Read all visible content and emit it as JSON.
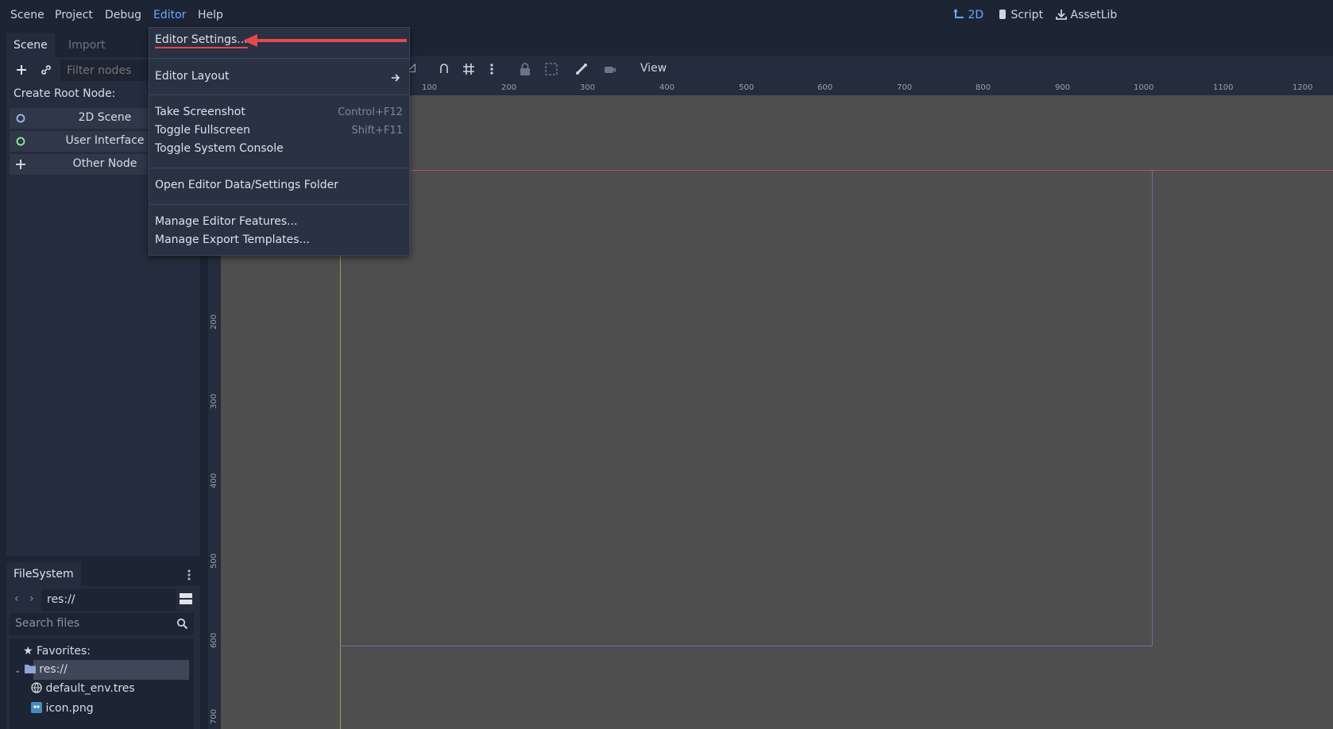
{
  "menubar": {
    "items": [
      "Scene",
      "Project",
      "Debug",
      "Editor",
      "Help"
    ],
    "active_index": 3
  },
  "workspaces": [
    {
      "label": "2D",
      "icon": "2d-icon",
      "active": true
    },
    {
      "label": "Script",
      "icon": "script-icon",
      "active": false
    },
    {
      "label": "AssetLib",
      "icon": "assetlib-icon",
      "active": false
    }
  ],
  "scene_dock": {
    "tabs": [
      "Scene",
      "Import"
    ],
    "filter_placeholder": "Filter nodes",
    "create_root_label": "Create Root Node:",
    "root_options": [
      {
        "label": "2D Scene",
        "icon": "node2d-icon"
      },
      {
        "label": "User Interface",
        "icon": "control-icon"
      },
      {
        "label": "Other Node",
        "icon": "add-icon"
      }
    ]
  },
  "filesystem": {
    "title": "FileSystem",
    "path": "res://",
    "search_placeholder": "Search files",
    "favorites_label": "Favorites:",
    "root_label": "res://",
    "files": [
      {
        "name": "default_env.tres",
        "icon": "globe-icon"
      },
      {
        "name": "icon.png",
        "icon": "image-icon"
      }
    ]
  },
  "toolbar": {
    "view_label": "View"
  },
  "rulers": {
    "horizontal": [
      "100",
      "200",
      "300",
      "400",
      "500",
      "600",
      "700",
      "800",
      "900",
      "1000",
      "1100",
      "1200"
    ],
    "vertical": [
      "200",
      "300",
      "400",
      "500",
      "600",
      "700"
    ]
  },
  "editor_menu": {
    "items": [
      {
        "label": "Editor Settings...",
        "shortcut": ""
      },
      {
        "label": "Editor Layout",
        "shortcut": ""
      },
      {
        "label": "Take Screenshot",
        "shortcut": "Control+F12"
      },
      {
        "label": "Toggle Fullscreen",
        "shortcut": "Shift+F11"
      },
      {
        "label": "Toggle System Console",
        "shortcut": ""
      },
      {
        "label": "Open Editor Data/Settings Folder",
        "shortcut": ""
      },
      {
        "label": "Manage Editor Features...",
        "shortcut": ""
      },
      {
        "label": "Manage Export Templates...",
        "shortcut": ""
      }
    ]
  },
  "colors": {
    "accent": "#6aa8ff",
    "annotation_arrow": "#e5484d",
    "viewport_bg": "#4e4e4e"
  }
}
